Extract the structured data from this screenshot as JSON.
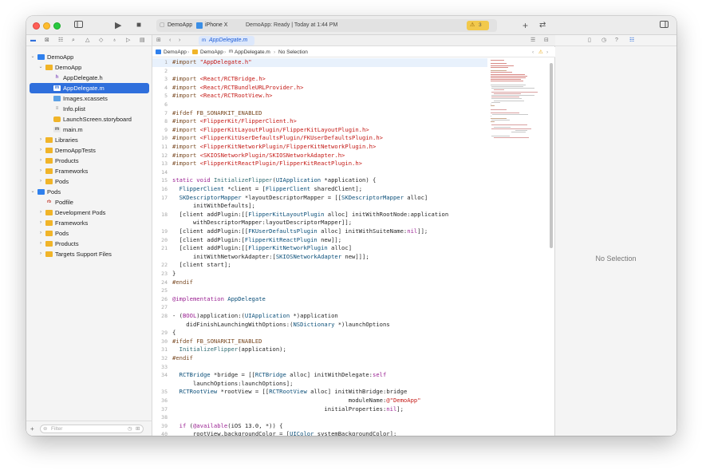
{
  "titlebar": {
    "run_icon": "play-icon",
    "stop_icon": "stop-icon",
    "scheme": "DemoApp",
    "device": "iPhone X",
    "status": "DemoApp: Ready | Today at 1:44 PM",
    "warning_count": "3",
    "add_icon": "plus-icon",
    "back_forward_icon": "return-arrows-icon"
  },
  "navigator": {
    "filter_placeholder": "Filter",
    "add_label": "+",
    "items": [
      {
        "label": "DemoApp",
        "depth": 0,
        "disclosure": "v",
        "icon": "project"
      },
      {
        "label": "DemoApp",
        "depth": 1,
        "disclosure": "v",
        "icon": "folder"
      },
      {
        "label": "AppDelegate.h",
        "depth": 2,
        "disclosure": "",
        "icon": "h"
      },
      {
        "label": "AppDelegate.m",
        "depth": 2,
        "disclosure": "",
        "icon": "m",
        "selected": true
      },
      {
        "label": "Images.xcassets",
        "depth": 2,
        "disclosure": "",
        "icon": "assets"
      },
      {
        "label": "Info.plist",
        "depth": 2,
        "disclosure": "",
        "icon": "plist"
      },
      {
        "label": "LaunchScreen.storyboard",
        "depth": 2,
        "disclosure": "",
        "icon": "storyboard"
      },
      {
        "label": "main.m",
        "depth": 2,
        "disclosure": "",
        "icon": "m"
      },
      {
        "label": "Libraries",
        "depth": 1,
        "disclosure": ">",
        "icon": "folder"
      },
      {
        "label": "DemoAppTests",
        "depth": 1,
        "disclosure": ">",
        "icon": "folder"
      },
      {
        "label": "Products",
        "depth": 1,
        "disclosure": ">",
        "icon": "folder"
      },
      {
        "label": "Frameworks",
        "depth": 1,
        "disclosure": ">",
        "icon": "folder"
      },
      {
        "label": "Pods",
        "depth": 1,
        "disclosure": ">",
        "icon": "folder"
      },
      {
        "label": "Pods",
        "depth": 0,
        "disclosure": "v",
        "icon": "project"
      },
      {
        "label": "Podfile",
        "depth": 1,
        "disclosure": "",
        "icon": "podfile"
      },
      {
        "label": "Development Pods",
        "depth": 1,
        "disclosure": ">",
        "icon": "folder"
      },
      {
        "label": "Frameworks",
        "depth": 1,
        "disclosure": ">",
        "icon": "folder"
      },
      {
        "label": "Pods",
        "depth": 1,
        "disclosure": ">",
        "icon": "folder"
      },
      {
        "label": "Products",
        "depth": 1,
        "disclosure": ">",
        "icon": "folder"
      },
      {
        "label": "Targets Support Files",
        "depth": 1,
        "disclosure": ">",
        "icon": "folder"
      }
    ]
  },
  "editor": {
    "active_tab": "AppDelegate.m",
    "jumpbar": {
      "project": "DemoApp",
      "group": "DemoApp",
      "file": "AppDelegate.m",
      "selection": "No Selection"
    },
    "lines": [
      {
        "n": "1",
        "text": "#import \"AppDelegate.h\"",
        "kind": "pp-str",
        "current": true
      },
      {
        "n": "2",
        "text": "",
        "kind": "plain"
      },
      {
        "n": "3",
        "text": "#import <React/RCTBridge.h>",
        "kind": "pp-str"
      },
      {
        "n": "4",
        "text": "#import <React/RCTBundleURLProvider.h>",
        "kind": "pp-str"
      },
      {
        "n": "5",
        "text": "#import <React/RCTRootView.h>",
        "kind": "pp-str"
      },
      {
        "n": "6",
        "text": "",
        "kind": "plain"
      },
      {
        "n": "7",
        "text": "#ifdef FB_SONARKIT_ENABLED",
        "kind": "pp"
      },
      {
        "n": "8",
        "text": "#import <FlipperKit/FlipperClient.h>",
        "kind": "pp-str"
      },
      {
        "n": "9",
        "text": "#import <FlipperKitLayoutPlugin/FlipperKitLayoutPlugin.h>",
        "kind": "pp-str"
      },
      {
        "n": "10",
        "text": "#import <FlipperKitUserDefaultsPlugin/FKUserDefaultsPlugin.h>",
        "kind": "pp-str"
      },
      {
        "n": "11",
        "text": "#import <FlipperKitNetworkPlugin/FlipperKitNetworkPlugin.h>",
        "kind": "pp-str"
      },
      {
        "n": "12",
        "text": "#import <SKIOSNetworkPlugin/SKIOSNetworkAdapter.h>",
        "kind": "pp-str"
      },
      {
        "n": "13",
        "text": "#import <FlipperKitReactPlugin/FlipperKitReactPlugin.h>",
        "kind": "pp-str"
      },
      {
        "n": "14",
        "text": "",
        "kind": "plain"
      },
      {
        "n": "15",
        "text": "static void InitializeFlipper(UIApplication *application) {",
        "kind": "plain"
      },
      {
        "n": "16",
        "text": "  FlipperClient *client = [FlipperClient sharedClient];",
        "kind": "plain"
      },
      {
        "n": "17",
        "text": "  SKDescriptorMapper *layoutDescriptorMapper = [[SKDescriptorMapper alloc]",
        "kind": "plain"
      },
      {
        "n": "",
        "text": "      initWithDefaults];",
        "kind": "plain"
      },
      {
        "n": "18",
        "text": "  [client addPlugin:[[FlipperKitLayoutPlugin alloc] initWithRootNode:application",
        "kind": "plain"
      },
      {
        "n": "",
        "text": "      withDescriptorMapper:layoutDescriptorMapper]];",
        "kind": "plain"
      },
      {
        "n": "19",
        "text": "  [client addPlugin:[[FKUserDefaultsPlugin alloc] initWithSuiteName:nil]];",
        "kind": "plain"
      },
      {
        "n": "20",
        "text": "  [client addPlugin:[FlipperKitReactPlugin new]];",
        "kind": "plain"
      },
      {
        "n": "21",
        "text": "  [client addPlugin:[[FlipperKitNetworkPlugin alloc]",
        "kind": "plain"
      },
      {
        "n": "",
        "text": "      initWithNetworkAdapter:[SKIOSNetworkAdapter new]]];",
        "kind": "plain"
      },
      {
        "n": "22",
        "text": "  [client start];",
        "kind": "plain"
      },
      {
        "n": "23",
        "text": "}",
        "kind": "plain"
      },
      {
        "n": "24",
        "text": "#endif",
        "kind": "pp"
      },
      {
        "n": "25",
        "text": "",
        "kind": "plain"
      },
      {
        "n": "26",
        "text": "@implementation AppDelegate",
        "kind": "kw"
      },
      {
        "n": "27",
        "text": "",
        "kind": "plain"
      },
      {
        "n": "28",
        "text": "- (BOOL)application:(UIApplication *)application",
        "kind": "plain"
      },
      {
        "n": "",
        "text": "    didFinishLaunchingWithOptions:(NSDictionary *)launchOptions",
        "kind": "plain"
      },
      {
        "n": "29",
        "text": "{",
        "kind": "plain"
      },
      {
        "n": "30",
        "text": "#ifdef FB_SONARKIT_ENABLED",
        "kind": "pp"
      },
      {
        "n": "31",
        "text": "  InitializeFlipper(application);",
        "kind": "plain"
      },
      {
        "n": "32",
        "text": "#endif",
        "kind": "pp"
      },
      {
        "n": "33",
        "text": "",
        "kind": "plain"
      },
      {
        "n": "34",
        "text": "  RCTBridge *bridge = [[RCTBridge alloc] initWithDelegate:self",
        "kind": "plain"
      },
      {
        "n": "",
        "text": "      launchOptions:launchOptions];",
        "kind": "plain"
      },
      {
        "n": "35",
        "text": "  RCTRootView *rootView = [[RCTRootView alloc] initWithBridge:bridge",
        "kind": "plain"
      },
      {
        "n": "36",
        "text": "                                                   moduleName:@\"DemoApp\"",
        "kind": "plain"
      },
      {
        "n": "37",
        "text": "                                            initialProperties:nil];",
        "kind": "plain"
      },
      {
        "n": "38",
        "text": "",
        "kind": "plain"
      },
      {
        "n": "39",
        "text": "  if (@available(iOS 13.0, *)) {",
        "kind": "plain"
      },
      {
        "n": "40",
        "text": "      rootView.backgroundColor = [UIColor systemBackgroundColor];",
        "kind": "plain"
      }
    ]
  },
  "inspector": {
    "no_selection": "No Selection"
  },
  "colors": {
    "selection": "#2f6fdc",
    "preprocessor": "#7a4a23",
    "string": "#c41a16",
    "keyword": "#9b2393",
    "warning": "#f2c94c"
  }
}
